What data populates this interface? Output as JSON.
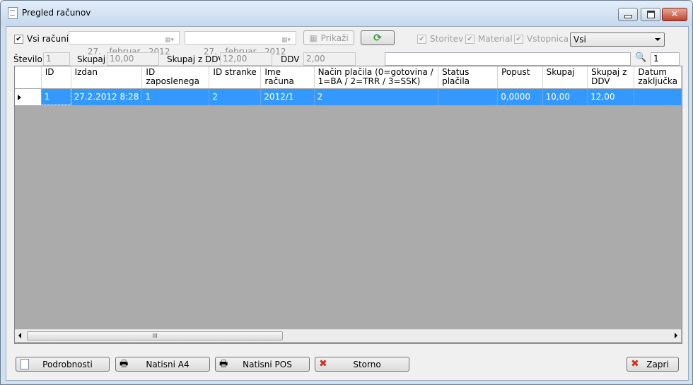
{
  "window": {
    "title": "Pregled računov"
  },
  "filters": {
    "vsi_racuni_label": "Vsi računi",
    "vsi_racuni_checked": true,
    "date_from": "27.   februar   2012",
    "date_to": "27.   februar   2012",
    "prikazi_label": "Prikaži",
    "storitev_label": "Storitev",
    "material_label": "Material",
    "vstopnica_label": "Vstopnica",
    "type_select_value": "Vsi"
  },
  "summary": {
    "stevilo_label": "Število",
    "stevilo_value": "1",
    "skupaj_label": "Skupaj",
    "skupaj_value": "10,00",
    "skupaj_ddv_label": "Skupaj z DDV",
    "skupaj_ddv_value": "12,00",
    "ddv_label": "DDV",
    "ddv_value": "2,00",
    "search_value": "",
    "search_count": "1"
  },
  "grid": {
    "columns": [
      "ID",
      "Izdan",
      "ID zaposlenega",
      "ID stranke",
      "Ime računa",
      "Način plačila (0=gotovina / 1=BA / 2=TRR / 3=SSK)",
      "Status plačila",
      "Popust",
      "Skupaj",
      "Skupaj z DDV",
      "Datum zaključka"
    ],
    "rows": [
      [
        "1",
        "27.2.2012 8:28",
        "1",
        "2",
        "2012/1",
        "2",
        "",
        "0,0000",
        "10,00",
        "12,00",
        ""
      ]
    ],
    "scroll_grip": "III"
  },
  "actions": {
    "podrobnosti": "Podrobnosti",
    "natisni_a4": "Natisni A4",
    "natisni_pos": "Natisni POS",
    "storno": "Storno",
    "zapri": "Zapri"
  },
  "colors": {
    "selection": "#3399ff",
    "window_frame": "#cfe0f1",
    "client_bg": "#f0f0f0"
  }
}
